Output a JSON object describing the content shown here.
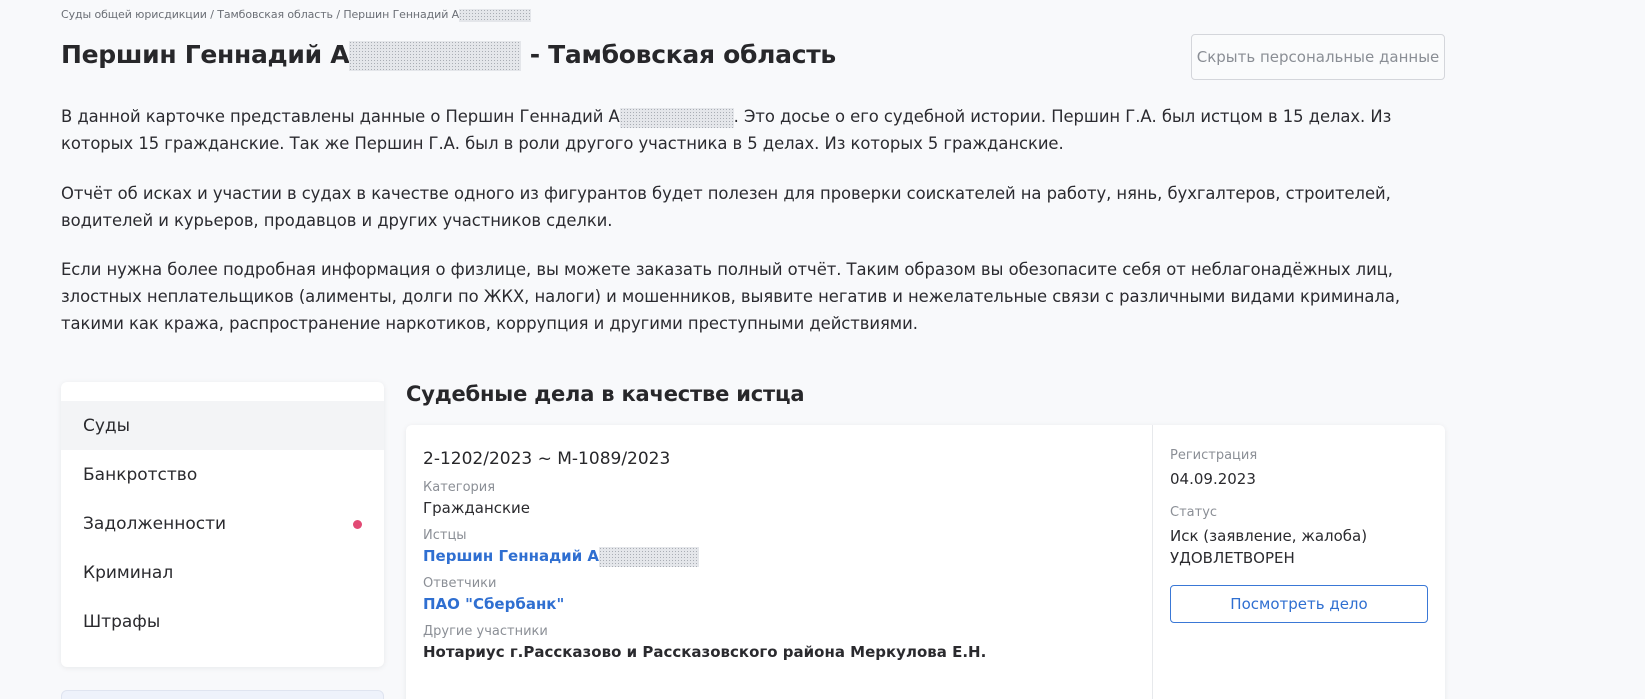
{
  "breadcrumb": {
    "items": [
      "Суды общей юрисдикции",
      "Тамбовская область",
      "Першин Геннадий А"
    ],
    "separator": " / "
  },
  "title": {
    "name": "Першин Геннадий А",
    "region_suffix": " - Тамбовская область"
  },
  "hide_button": "Скрыть персональные данные",
  "intro": {
    "p1_before": "В данной карточке представлены данные о Першин Геннадий А",
    "p1_after": ". Это досье о его судебной истории. Першин Г.А. был истцом в 15 делах. Из которых 15 гражданские. Так же Першин Г.А. был в роли другого участника в 5 делах. Из которых 5 гражданские.",
    "p2": "Отчёт об исках и участии в судах в качестве одного из фигурантов будет полезен для проверки соискателей на работу, нянь, бухгалтеров, строителей, водителей и курьеров, продавцов и других участников сделки.",
    "p3": "Если нужна более подробная информация о физлице, вы можете заказать полный отчёт. Таким образом вы обезопасите себя от неблагонадёжных лиц, злостных неплательщиков (алименты, долги по ЖКХ, налоги) и мошенников, выявите негатив и нежелательные связи с различными видами криминала, такими как кража, распространение наркотиков, коррупция и другими преступными действиями."
  },
  "sidebar": {
    "items": [
      {
        "label": "Суды",
        "active": true
      },
      {
        "label": "Банкротство"
      },
      {
        "label": "Задолженности",
        "indicator": "#e24a74"
      },
      {
        "label": "Криминал"
      },
      {
        "label": "Штрафы"
      }
    ]
  },
  "section_title": "Судебные дела в качестве истца",
  "case": {
    "number": "2-1202/2023 ~ М-1089/2023",
    "category_label": "Категория",
    "category": "Гражданские",
    "plaintiffs_label": "Истцы",
    "plaintiff": "Першин Геннадий А",
    "defendants_label": "Ответчики",
    "defendant": "ПАО \"Сбербанк\"",
    "others_label": "Другие участники",
    "other": "Нотариус г.Рассказово и Рассказовского района Меркулова Е.Н.",
    "registration_label": "Регистрация",
    "registration": "04.09.2023",
    "status_label": "Статус",
    "status_line1": "Иск (заявление, жалоба)",
    "status_line2": "УДОВЛЕТВОРЕН",
    "view_button": "Посмотреть дело"
  },
  "colors": {
    "link": "#2f6fd1",
    "indicator": "#e24a74",
    "background": "#f8f9fb"
  }
}
